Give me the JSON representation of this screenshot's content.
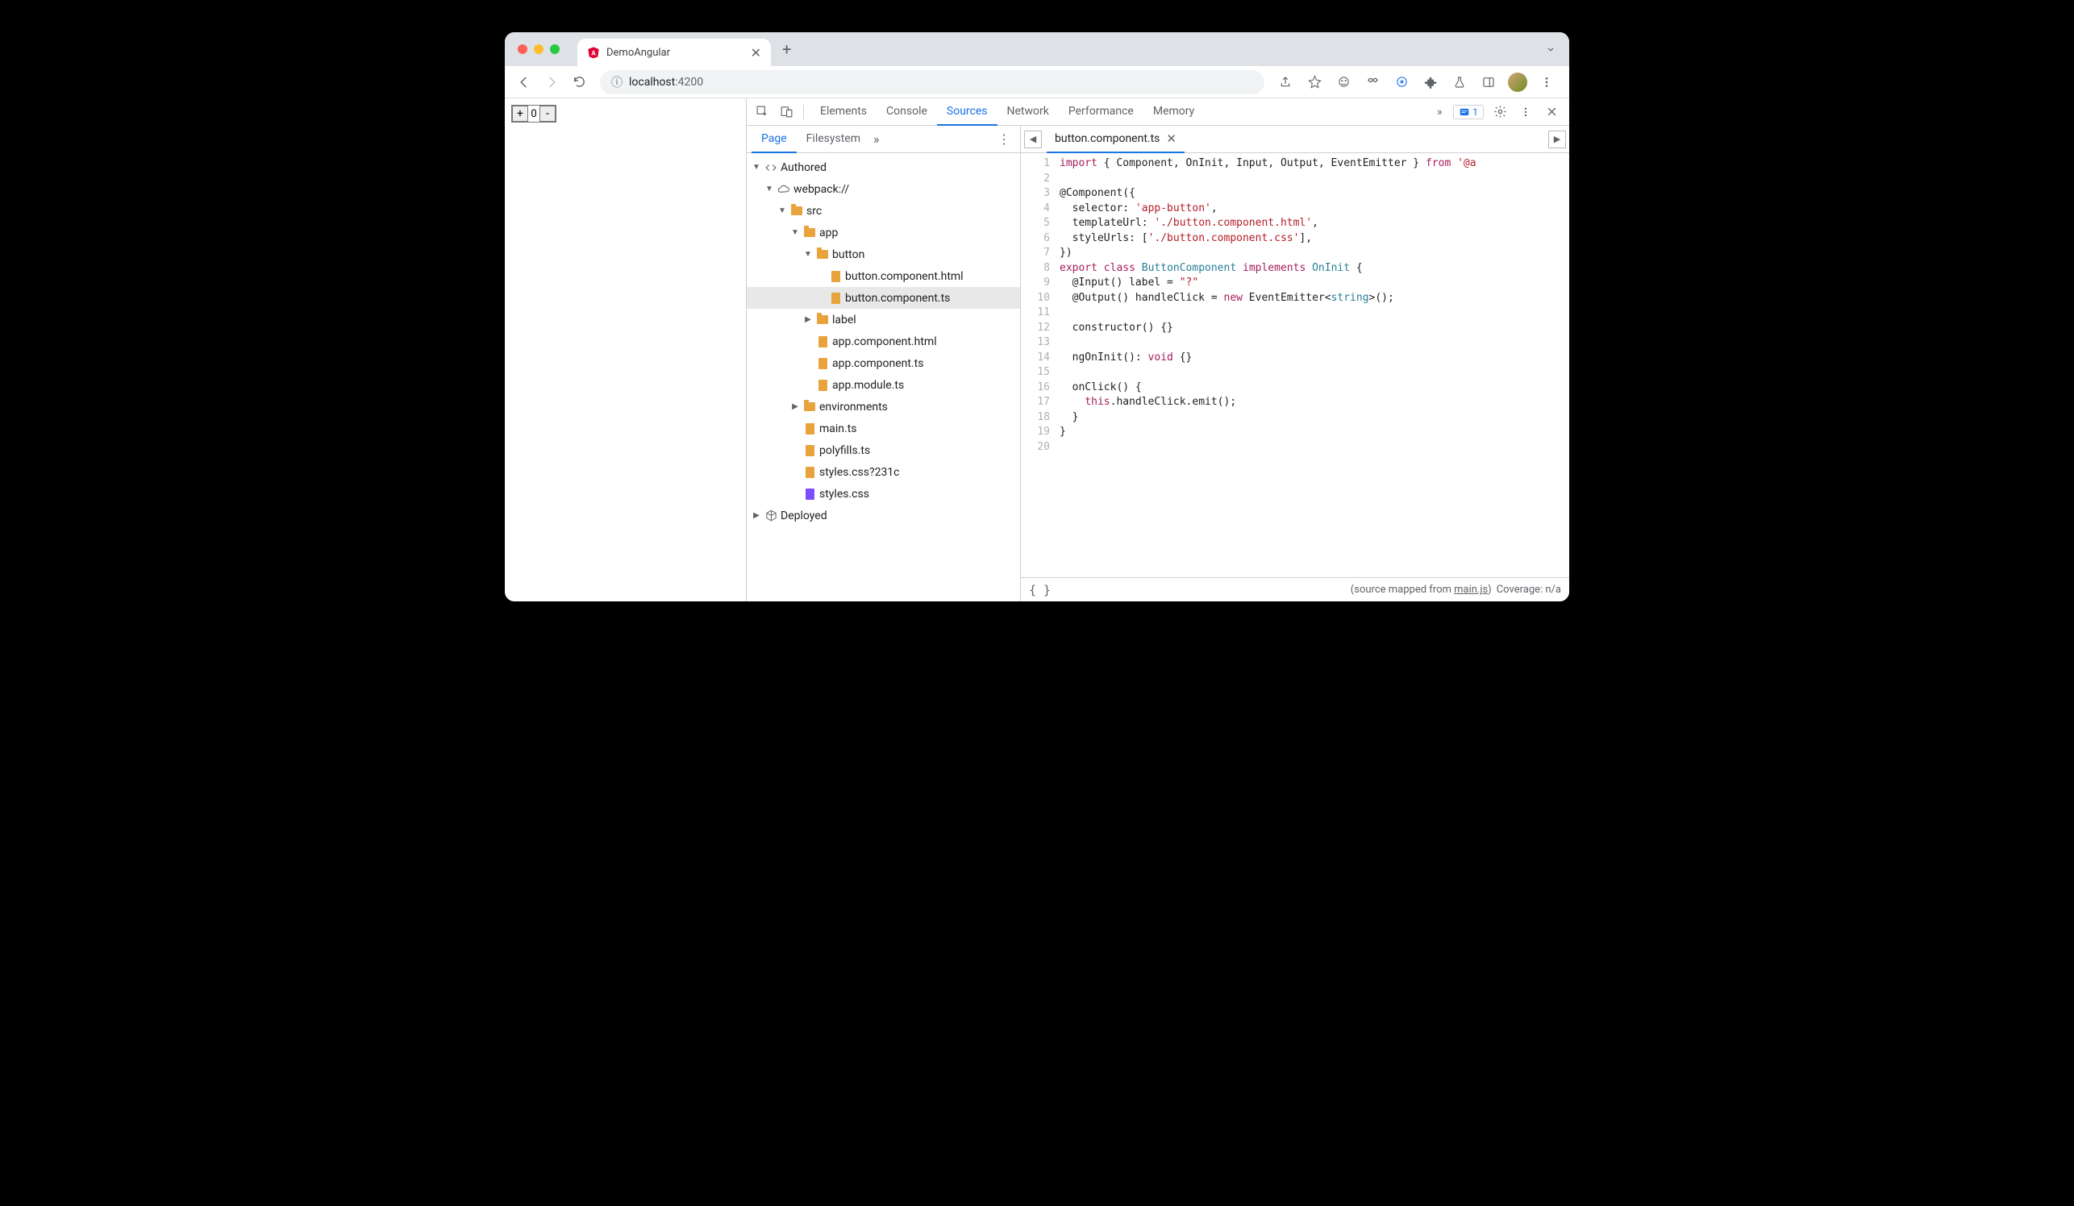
{
  "browser": {
    "tab_title": "DemoAngular",
    "url_host": "localhost",
    "url_port": ":4200"
  },
  "page_content": {
    "counter_value": "0",
    "plus_label": "+",
    "minus_label": "-"
  },
  "devtools": {
    "tabs": [
      "Elements",
      "Console",
      "Sources",
      "Network",
      "Performance",
      "Memory"
    ],
    "active_tab": "Sources",
    "issues_count": "1"
  },
  "sources_nav": {
    "tabs": [
      "Page",
      "Filesystem"
    ],
    "active_tab": "Page",
    "tree": {
      "authored": "Authored",
      "webpack": "webpack://",
      "src": "src",
      "app": "app",
      "button": "button",
      "button_html": "button.component.html",
      "button_ts": "button.component.ts",
      "label": "label",
      "app_html": "app.component.html",
      "app_ts": "app.component.ts",
      "app_module": "app.module.ts",
      "environments": "environments",
      "main_ts": "main.ts",
      "polyfills": "polyfills.ts",
      "styles_q": "styles.css?231c",
      "styles": "styles.css",
      "deployed": "Deployed"
    }
  },
  "editor": {
    "open_file": "button.component.ts",
    "line_count": 20,
    "code_lines": [
      [
        {
          "t": "kw",
          "s": "import"
        },
        {
          "t": "",
          "s": " { Component, OnInit, Input, Output, EventEmitter } "
        },
        {
          "t": "kw",
          "s": "from"
        },
        {
          "t": "",
          "s": " "
        },
        {
          "t": "str",
          "s": "'@a"
        }
      ],
      [],
      [
        {
          "t": "",
          "s": "@Component({"
        }
      ],
      [
        {
          "t": "",
          "s": "  selector: "
        },
        {
          "t": "str",
          "s": "'app-button'"
        },
        {
          "t": "",
          "s": ","
        }
      ],
      [
        {
          "t": "",
          "s": "  templateUrl: "
        },
        {
          "t": "str",
          "s": "'./button.component.html'"
        },
        {
          "t": "",
          "s": ","
        }
      ],
      [
        {
          "t": "",
          "s": "  styleUrls: ["
        },
        {
          "t": "str",
          "s": "'./button.component.css'"
        },
        {
          "t": "",
          "s": "],"
        }
      ],
      [
        {
          "t": "",
          "s": "})"
        }
      ],
      [
        {
          "t": "kw",
          "s": "export"
        },
        {
          "t": "",
          "s": " "
        },
        {
          "t": "kw",
          "s": "class"
        },
        {
          "t": "",
          "s": " "
        },
        {
          "t": "type",
          "s": "ButtonComponent"
        },
        {
          "t": "",
          "s": " "
        },
        {
          "t": "kw",
          "s": "implements"
        },
        {
          "t": "",
          "s": " "
        },
        {
          "t": "type",
          "s": "OnInit"
        },
        {
          "t": "",
          "s": " {"
        }
      ],
      [
        {
          "t": "",
          "s": "  @Input() label = "
        },
        {
          "t": "str",
          "s": "\"?\""
        }
      ],
      [
        {
          "t": "",
          "s": "  @Output() handleClick = "
        },
        {
          "t": "kw",
          "s": "new"
        },
        {
          "t": "",
          "s": " EventEmitter<"
        },
        {
          "t": "type",
          "s": "string"
        },
        {
          "t": "",
          "s": ">();"
        }
      ],
      [],
      [
        {
          "t": "",
          "s": "  constructor() {}"
        }
      ],
      [],
      [
        {
          "t": "",
          "s": "  ngOnInit(): "
        },
        {
          "t": "kw",
          "s": "void"
        },
        {
          "t": "",
          "s": " {}"
        }
      ],
      [],
      [
        {
          "t": "",
          "s": "  onClick() {"
        }
      ],
      [
        {
          "t": "",
          "s": "    "
        },
        {
          "t": "kw",
          "s": "this"
        },
        {
          "t": "",
          "s": ".handleClick.emit();"
        }
      ],
      [
        {
          "t": "",
          "s": "  }"
        }
      ],
      [
        {
          "t": "",
          "s": "}"
        }
      ],
      []
    ]
  },
  "status_bar": {
    "mapped_prefix": "(source mapped from ",
    "mapped_link": "main.js",
    "mapped_suffix": ")",
    "coverage": "Coverage: n/a"
  }
}
